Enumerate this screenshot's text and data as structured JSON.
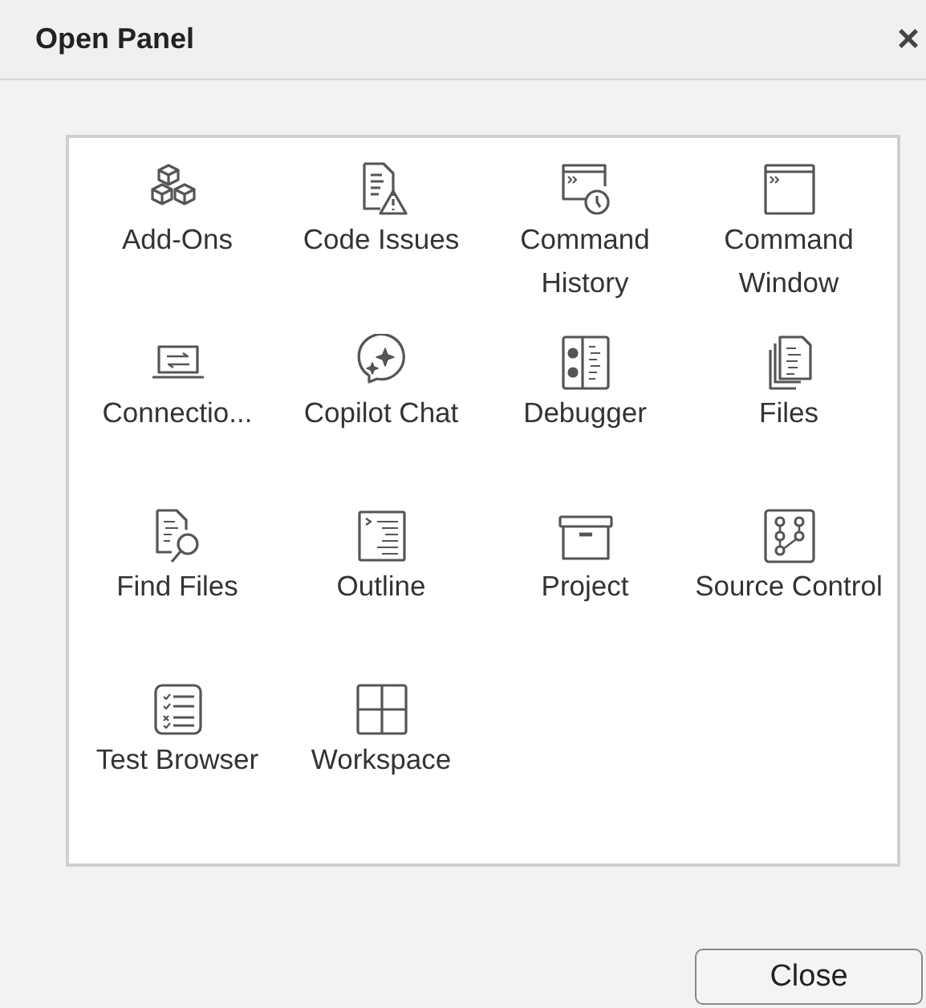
{
  "window": {
    "title": "Open Panel",
    "close_glyph": "×"
  },
  "panels": [
    {
      "kind": "addons",
      "label": "Add-Ons"
    },
    {
      "kind": "issues",
      "label": "Code Issues"
    },
    {
      "kind": "history",
      "label": "Command History"
    },
    {
      "kind": "cmdwin",
      "label": "Command Window"
    },
    {
      "kind": "connections",
      "label": "Connectio..."
    },
    {
      "kind": "copilot",
      "label": "Copilot Chat"
    },
    {
      "kind": "debugger",
      "label": "Debugger"
    },
    {
      "kind": "files",
      "label": "Files"
    },
    {
      "kind": "findfiles",
      "label": "Find Files"
    },
    {
      "kind": "outline",
      "label": "Outline"
    },
    {
      "kind": "project",
      "label": "Project"
    },
    {
      "kind": "source",
      "label": "Source Control"
    },
    {
      "kind": "tests",
      "label": "Test Browser"
    },
    {
      "kind": "workspace",
      "label": "Workspace"
    }
  ],
  "buttons": [
    "Close"
  ]
}
